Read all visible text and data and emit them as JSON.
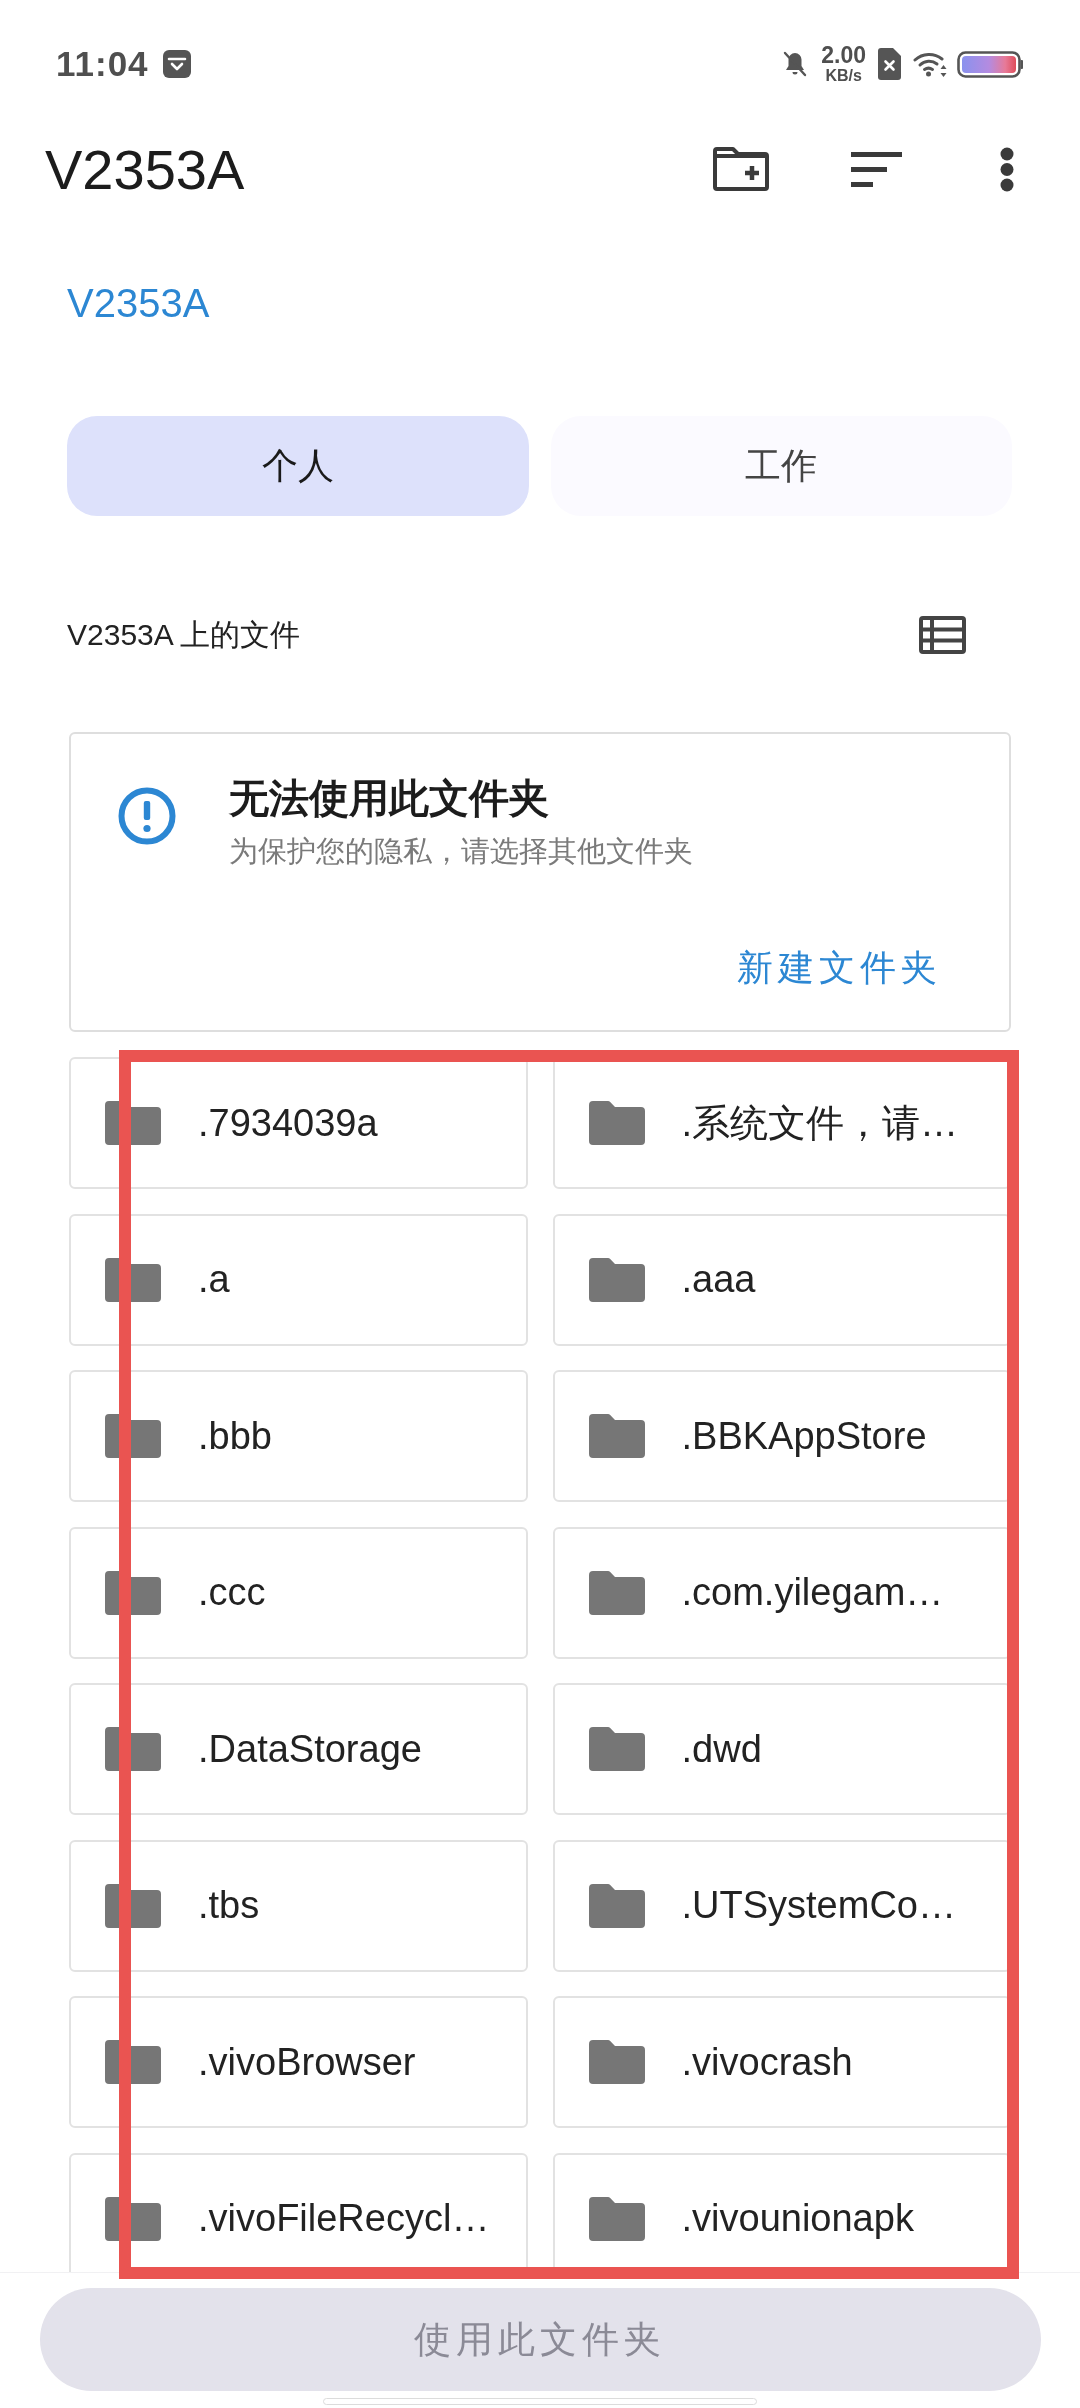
{
  "status_bar": {
    "time": "11:04",
    "net_speed": {
      "value": "2.00",
      "unit": "KB/s"
    }
  },
  "app_bar": {
    "title": "V2353A"
  },
  "breadcrumb": {
    "label": "V2353A"
  },
  "profile_tabs": [
    {
      "label": "个人",
      "selected": true
    },
    {
      "label": "工作",
      "selected": false
    }
  ],
  "section": {
    "title": "V2353A 上的文件"
  },
  "notice": {
    "title": "无法使用此文件夹",
    "message": "为保护您的隐私，请选择其他文件夹",
    "action": "新建文件夹"
  },
  "folders": [
    {
      "name": ".7934039a"
    },
    {
      "name": ".系统文件，请…"
    },
    {
      "name": ".a"
    },
    {
      "name": ".aaa"
    },
    {
      "name": ".bbb"
    },
    {
      "name": ".BBKAppStore"
    },
    {
      "name": ".ccc"
    },
    {
      "name": ".com.yilegam…"
    },
    {
      "name": ".DataStorage"
    },
    {
      "name": ".dwd"
    },
    {
      "name": ".tbs"
    },
    {
      "name": ".UTSystemCo…"
    },
    {
      "name": ".vivoBrowser"
    },
    {
      "name": ".vivocrash"
    },
    {
      "name": ".vivoFileRecycl…"
    },
    {
      "name": ".vivounionapk"
    }
  ],
  "annotation": {
    "kind": "highlight-rectangle"
  },
  "confirm_button": {
    "label": "使用此文件夹",
    "disabled": true
  }
}
